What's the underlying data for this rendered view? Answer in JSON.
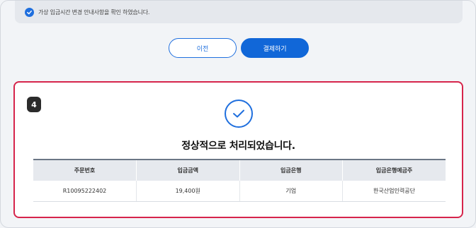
{
  "notice": {
    "text": "가상 입금시간 변경 안내사항을 확인 하였습니다."
  },
  "buttons": {
    "prev_label": "이전",
    "pay_label": "결제하기"
  },
  "result": {
    "step_number": "4",
    "title": "정상적으로 처리되었습니다.",
    "columns": [
      "주문번호",
      "입금금액",
      "입금은행",
      "입금은행예금주"
    ],
    "rows": [
      [
        "R10095222402",
        "19,400원",
        "기업",
        "한국산업인력공단"
      ]
    ]
  },
  "colors": {
    "accent": "#1f6fde",
    "panel_border": "#d6244b"
  },
  "icons": {
    "notice_check": "check-circle-icon",
    "success": "success-check-icon"
  }
}
